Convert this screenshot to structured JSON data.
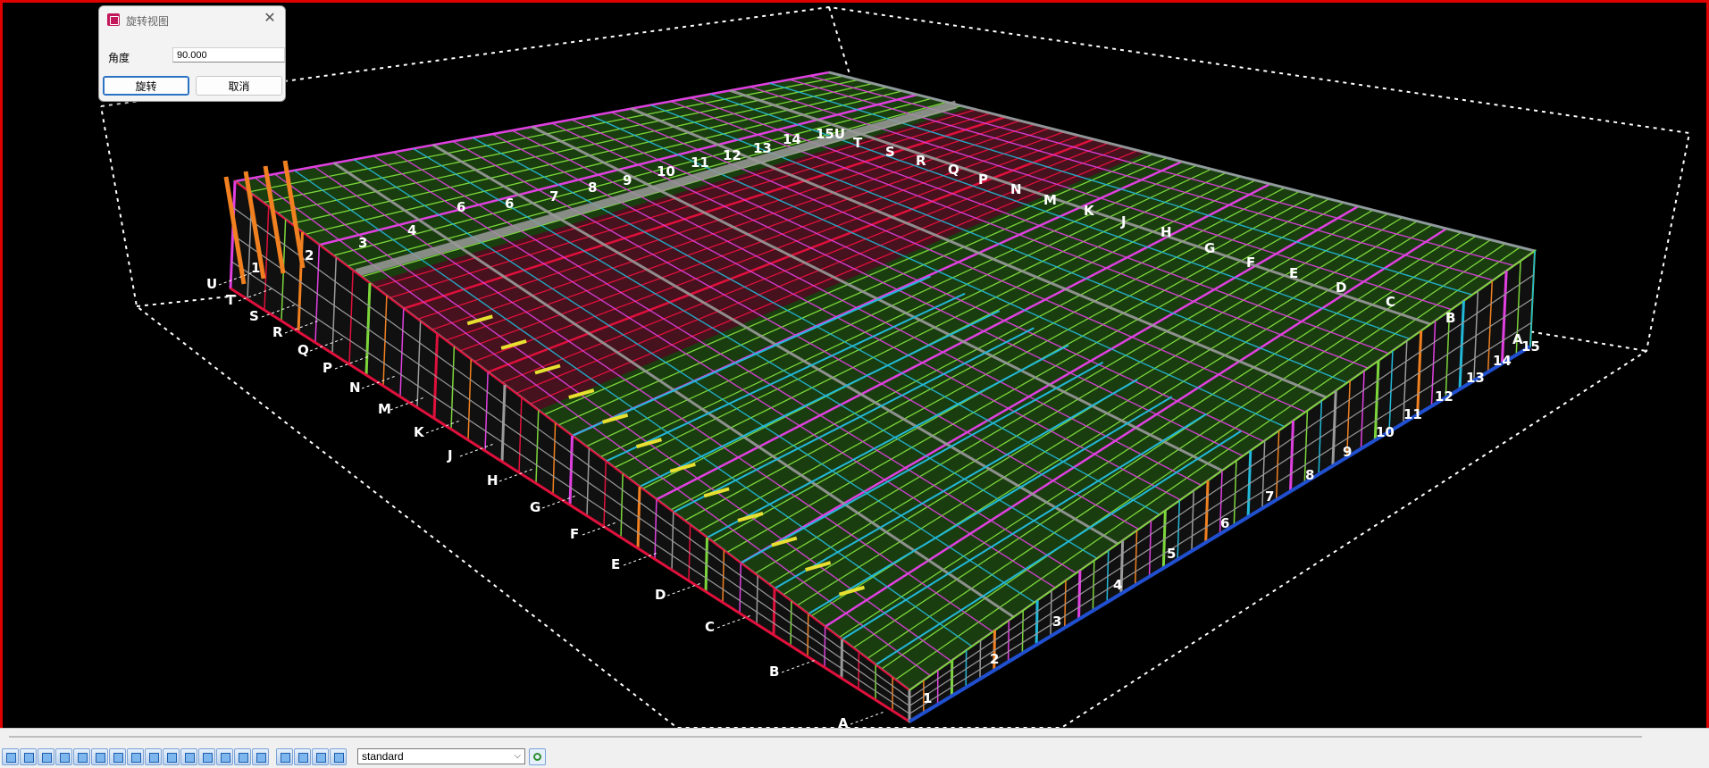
{
  "dialog": {
    "title": "旋转视图",
    "angle_label": "角度",
    "angle_value": "90.000",
    "rotate_button": "旋转",
    "cancel_button": "取消"
  },
  "statusbar": {
    "view_name": "standard"
  },
  "grid_labels": {
    "left_row": [
      "U",
      "T",
      "S",
      "R",
      "Q",
      "P",
      "N",
      "M",
      "K",
      "J",
      "H",
      "G",
      "F",
      "E",
      "D",
      "C",
      "B",
      "A"
    ],
    "front_numbers": [
      "1",
      "2",
      "3",
      "4",
      "5",
      "6",
      "7",
      "8",
      "9",
      "10",
      "11",
      "12",
      "13",
      "14",
      "15"
    ],
    "back_numbers": [
      "1",
      "2",
      "3",
      "4",
      "6",
      "6",
      "7",
      "8",
      "9",
      "10",
      "11",
      "12",
      "13",
      "14",
      "15U"
    ],
    "back_letters": [
      "T",
      "S",
      "R",
      "Q",
      "P",
      "N",
      "M",
      "K",
      "J",
      "H",
      "G",
      "F",
      "E",
      "D",
      "C",
      "B",
      "A"
    ]
  },
  "colors": {
    "frame_border": "#e00000",
    "beam_green": "#7cd63b",
    "beam_magenta": "#e040e0",
    "beam_red": "#e0103c",
    "beam_orange": "#f08020",
    "beam_cyan": "#22b8d8",
    "beam_grey": "#9a9a9a",
    "beam_yellow": "#e8e030",
    "beam_blue": "#2050d0"
  }
}
